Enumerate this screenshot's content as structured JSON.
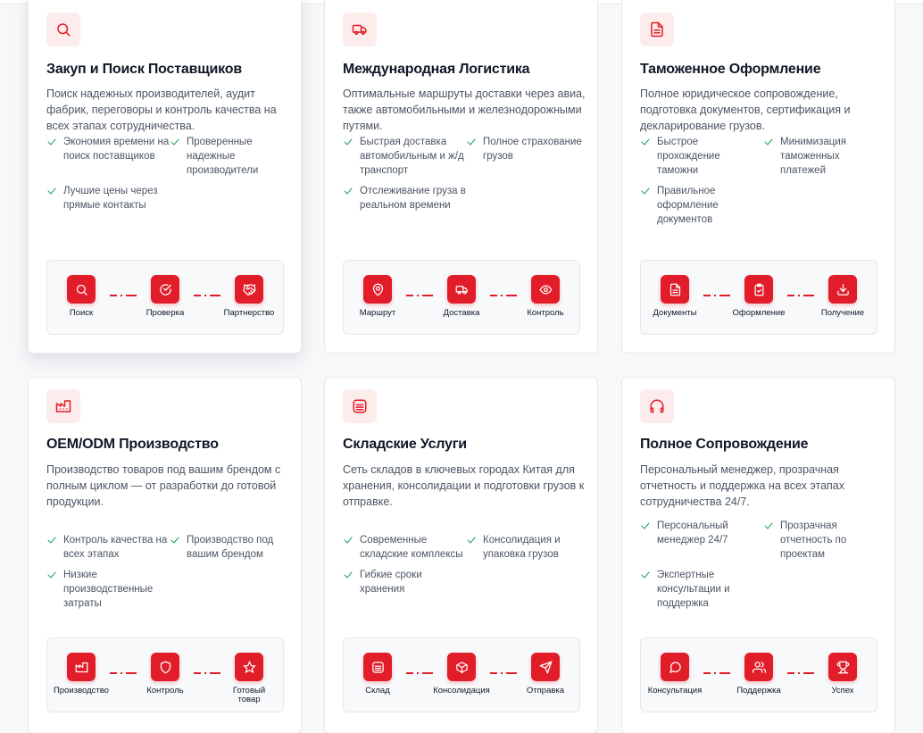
{
  "cards": [
    {
      "title": "Закуп и Поиск Поставщиков",
      "icon": "search-icon",
      "description": "Поиск надежных производителей, аудит фабрик, переговоры и контроль качества на всех этапах сотрудничества.",
      "features": [
        "Экономия времени на поиск поставщиков",
        "Проверенные надежные производители",
        "Лучшие цены через прямые контакты"
      ],
      "steps": [
        {
          "label": "Поиск",
          "icon": "search-icon"
        },
        {
          "label": "Проверка",
          "icon": "check-circle-icon"
        },
        {
          "label": "Партнерство",
          "icon": "handshake-icon"
        }
      ]
    },
    {
      "title": "Международная Логистика",
      "icon": "truck-icon",
      "description": "Оптимальные маршруты доставки через авиа, также автомобильными и железнодорожными путями.",
      "features": [
        "Быстрая доставка автомобильным и ж/д транспорт",
        "Полное страхование грузов",
        "Отслеживание груза в реальном времени"
      ],
      "steps": [
        {
          "label": "Маршрут",
          "icon": "map-pin-icon"
        },
        {
          "label": "Доставка",
          "icon": "truck-icon"
        },
        {
          "label": "Контроль",
          "icon": "eye-icon"
        }
      ]
    },
    {
      "title": "Таможенное Оформление",
      "icon": "document-icon",
      "description": "Полное юридическое сопровождение, подготовка документов, сертификация и декларирование грузов.",
      "features": [
        "Быстрое прохождение таможни",
        "Минимизация таможенных платежей",
        "Правильное оформление документов"
      ],
      "steps": [
        {
          "label": "Документы",
          "icon": "document-icon"
        },
        {
          "label": "Оформление",
          "icon": "clipboard-check-icon"
        },
        {
          "label": "Получение",
          "icon": "download-icon"
        }
      ]
    },
    {
      "title": "OEM/ODM Производство",
      "icon": "factory-icon",
      "description": "Производство товаров под вашим брендом с полным циклом — от разработки до готовой продукции.",
      "features": [
        "Контроль качества на всех этапах",
        "Производство под вашим брендом",
        "Низкие производственные затраты"
      ],
      "steps": [
        {
          "label": "Производство",
          "icon": "factory-icon"
        },
        {
          "label": "Контроль",
          "icon": "shield-icon"
        },
        {
          "label": "Готовый товар",
          "icon": "star-icon"
        }
      ]
    },
    {
      "title": "Складские Услуги",
      "icon": "warehouse-icon",
      "description": "Сеть складов в ключевых городах Китая для хранения, консолидации и подготовки грузов к отправке.",
      "features": [
        "Современные складские комплексы",
        "Консолидация и упаковка грузов",
        "Гибкие сроки хранения"
      ],
      "steps": [
        {
          "label": "Склад",
          "icon": "warehouse-icon"
        },
        {
          "label": "Консолидация",
          "icon": "package-icon"
        },
        {
          "label": "Отправка",
          "icon": "send-icon"
        }
      ]
    },
    {
      "title": "Полное Сопровождение",
      "icon": "headphones-icon",
      "description": "Персональный менеджер, прозрачная отчетность и поддержка на всех этапах сотрудничества 24/7.",
      "features": [
        "Персональный менеджер 24/7",
        "Прозрачная отчетность по проектам",
        "Экспертные консультации и поддержка"
      ],
      "steps": [
        {
          "label": "Консультация",
          "icon": "message-circle-icon"
        },
        {
          "label": "Поддержка",
          "icon": "users-icon"
        },
        {
          "label": "Успех",
          "icon": "trophy-icon"
        }
      ]
    }
  ],
  "colors": {
    "accent": "#e11d2a",
    "accent_soft": "#fdecec",
    "check": "#22a05b"
  }
}
